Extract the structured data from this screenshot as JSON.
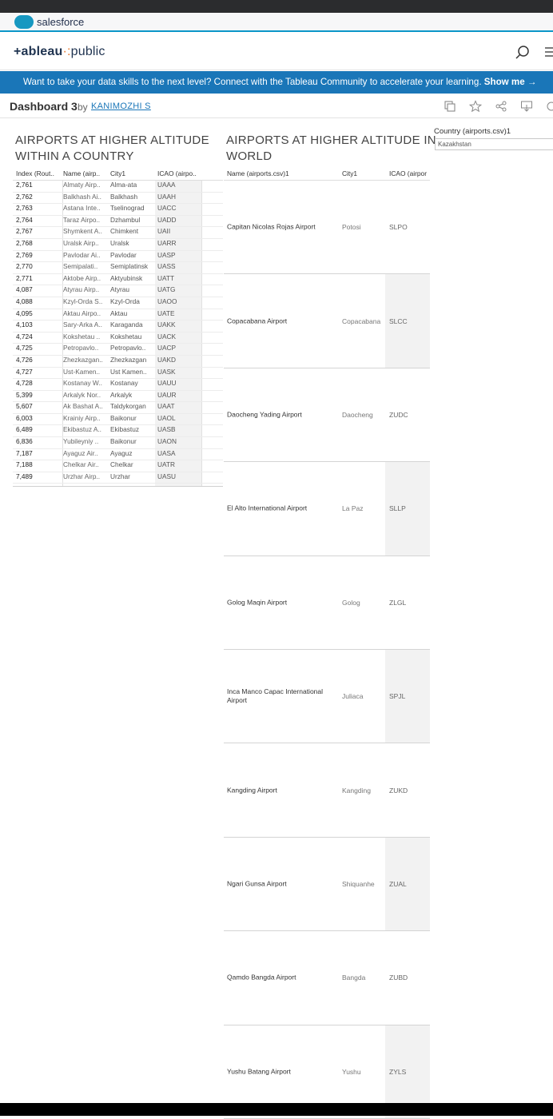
{
  "salesforce": {
    "brand": "salesforce"
  },
  "tableau": {
    "logo_main": "+ableau",
    "logo_dots": "·:",
    "logo_public": "public"
  },
  "banner": {
    "text": "Want to take your data skills to the next level? Connect with the Tableau Community to accelerate your learning. ",
    "cta": "Show me →"
  },
  "dashboard": {
    "title": "Dashboard 3",
    "by": "by",
    "author": "KANIMOZHI S"
  },
  "panel_left": {
    "title_line1": "AIRPORTS AT HIGHER ALTITUDE",
    "title_line2": "WITHIN A COUNTRY",
    "headers": [
      "Index (Rout..",
      "Name (airp..",
      "City1",
      "ICAO (airpo.."
    ],
    "rows": [
      [
        "2,761",
        "Almaty Airp..",
        "Alma-ata",
        "UAAA"
      ],
      [
        "2,762",
        "Balkhash Ai..",
        "Balkhash",
        "UAAH"
      ],
      [
        "2,763",
        "Astana Inte..",
        "Tselinograd",
        "UACC"
      ],
      [
        "2,764",
        "Taraz Airpo..",
        "Dzhambul",
        "UADD"
      ],
      [
        "2,767",
        "Shymkent A..",
        "Chimkent",
        "UAII"
      ],
      [
        "2,768",
        "Uralsk Airp..",
        "Uralsk",
        "UARR"
      ],
      [
        "2,769",
        "Pavlodar Ai..",
        "Pavlodar",
        "UASP"
      ],
      [
        "2,770",
        "Semipalati..",
        "Semiplatinsk",
        "UASS"
      ],
      [
        "2,771",
        "Aktobe Airp..",
        "Aktyubinsk",
        "UATT"
      ],
      [
        "4,087",
        "Atyrau Airp..",
        "Atyrau",
        "UATG"
      ],
      [
        "4,088",
        "Kzyl-Orda S..",
        "Kzyl-Orda",
        "UAOO"
      ],
      [
        "4,095",
        "Aktau Airpo..",
        "Aktau",
        "UATE"
      ],
      [
        "4,103",
        "Sary-Arka A..",
        "Karaganda",
        "UAKK"
      ],
      [
        "4,724",
        "Kokshetau ..",
        "Kokshetau",
        "UACK"
      ],
      [
        "4,725",
        "Petropavlo..",
        "Petropavlo..",
        "UACP"
      ],
      [
        "4,726",
        "Zhezkazgan..",
        "Zhezkazgan",
        "UAKD"
      ],
      [
        "4,727",
        "Ust-Kamen..",
        "Ust Kamen..",
        "UASK"
      ],
      [
        "4,728",
        "Kostanay W..",
        "Kostanay",
        "UAUU"
      ],
      [
        "5,399",
        "Arkalyk Nor..",
        "Arkalyk",
        "UAUR"
      ],
      [
        "5,607",
        "Ak Bashat A..",
        "Taldykorgan",
        "UAAT"
      ],
      [
        "6,003",
        "Krainiy Airp..",
        "Baikonur",
        "UAOL"
      ],
      [
        "6,489",
        "Ekibastuz A..",
        "Ekibastuz",
        "UASB"
      ],
      [
        "6,836",
        "Yubileyniy ..",
        "Baikonur",
        "UAON"
      ],
      [
        "7,187",
        "Ayaguz Air..",
        "Ayaguz",
        "UASA"
      ],
      [
        "7,188",
        "Chelkar Air..",
        "Chelkar",
        "UATR"
      ],
      [
        "7,489",
        "Urzhar Airp..",
        "Urzhar",
        "UASU"
      ]
    ]
  },
  "panel_right": {
    "title_line1": "AIRPORTS AT HIGHER ALTITUDE IN",
    "title_line2": "WORLD",
    "headers": [
      "Name (airports.csv)1",
      "City1",
      "ICAO (airpor"
    ],
    "rows": [
      [
        "Capitan Nicolas Rojas Airport",
        "Potosi",
        "SLPO"
      ],
      [
        "Copacabana Airport",
        "Copacabana",
        "SLCC"
      ],
      [
        "Daocheng Yading Airport",
        "Daocheng",
        "ZUDC"
      ],
      [
        "El Alto International Airport",
        "La Paz",
        "SLLP"
      ],
      [
        "Golog Maqin Airport",
        "Golog",
        "ZLGL"
      ],
      [
        "Inca Manco Capac International Airport",
        "Juliaca",
        "SPJL"
      ],
      [
        "Kangding Airport",
        "Kangding",
        "ZUKD"
      ],
      [
        "Ngari Gunsa Airport",
        "Shiquanhe",
        "ZUAL"
      ],
      [
        "Qamdo Bangda Airport",
        "Bangda",
        "ZUBD"
      ],
      [
        "Yushu Batang Airport",
        "Yushu",
        "ZYLS"
      ]
    ]
  },
  "filter": {
    "label": "Country (airports.csv)1",
    "value": "Kazakhstan"
  }
}
